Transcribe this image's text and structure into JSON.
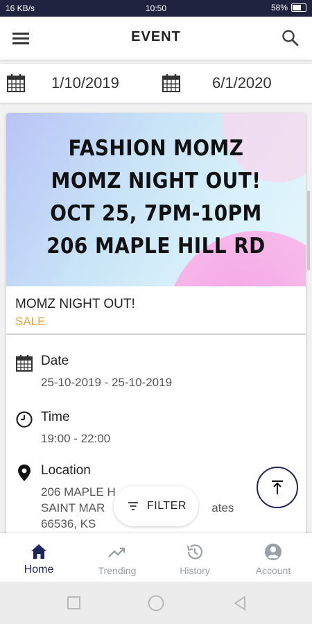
{
  "status_bar": {
    "network": "16 KB/s",
    "time": "10:50",
    "battery": "58%"
  },
  "app_bar": {
    "title": "EVENT"
  },
  "date_filter": {
    "start_date": "1/10/2019",
    "end_date": "6/1/2020"
  },
  "event": {
    "banner_lines": [
      "FASHION MOMZ",
      "MOMZ NIGHT OUT!",
      "OCT 25, 7PM-10PM",
      "206 MAPLE HILL RD"
    ],
    "title": "MOMZ NIGHT OUT!",
    "tag": "SALE",
    "tag_color": "#f2a03d",
    "date_label": "Date",
    "date_value": "25-10-2019 - 25-10-2019",
    "time_label": "Time",
    "time_value": "19:00 - 22:00",
    "location_label": "Location",
    "location_line1": "206 MAPLE H",
    "location_line2a": "SAINT MAR",
    "location_line2b": "ates",
    "location_line3": "66536, KS"
  },
  "filter_button": {
    "label": "FILTER"
  },
  "bottom_nav": {
    "accent": "#1e2660",
    "items": [
      {
        "label": "Home",
        "icon": "home-icon"
      },
      {
        "label": "Trending",
        "icon": "trending-icon"
      },
      {
        "label": "History",
        "icon": "history-icon"
      },
      {
        "label": "Account",
        "icon": "account-icon"
      }
    ]
  }
}
